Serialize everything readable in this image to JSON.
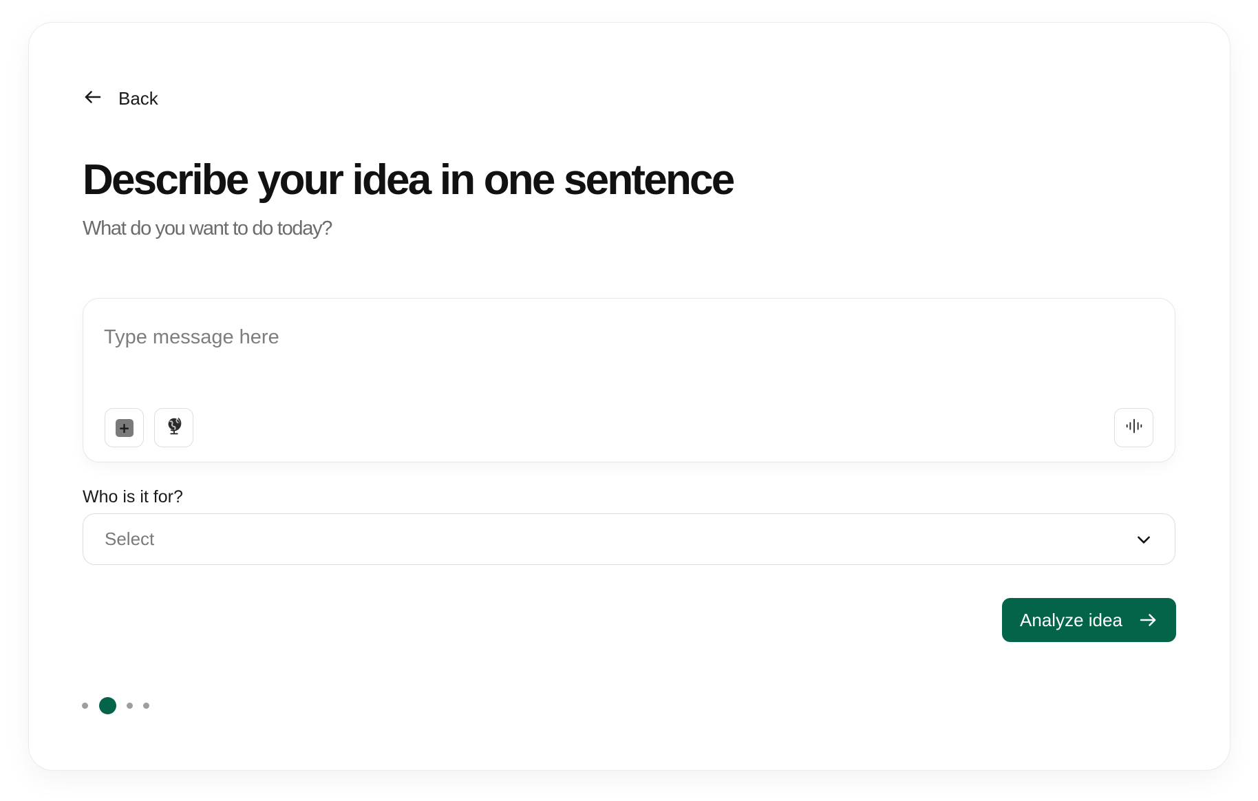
{
  "nav": {
    "back_label": "Back"
  },
  "header": {
    "title": "Describe your idea in one sentence",
    "subtitle": "What do you want to do today?"
  },
  "composer": {
    "placeholder": "Type message here",
    "value": "",
    "attach_icon": "plus-square-icon",
    "web_icon": "globe-icon",
    "voice_icon": "audio-waveform-icon"
  },
  "audience": {
    "label": "Who is it for?",
    "selected": "Select",
    "chevron_icon": "chevron-down-icon"
  },
  "cta": {
    "label": "Analyze idea",
    "icon": "arrow-right-icon",
    "color": "#03644a"
  },
  "pagination": {
    "total": 4,
    "current": 2,
    "active_color": "#03644a",
    "inactive_color": "#9e9e9e"
  }
}
